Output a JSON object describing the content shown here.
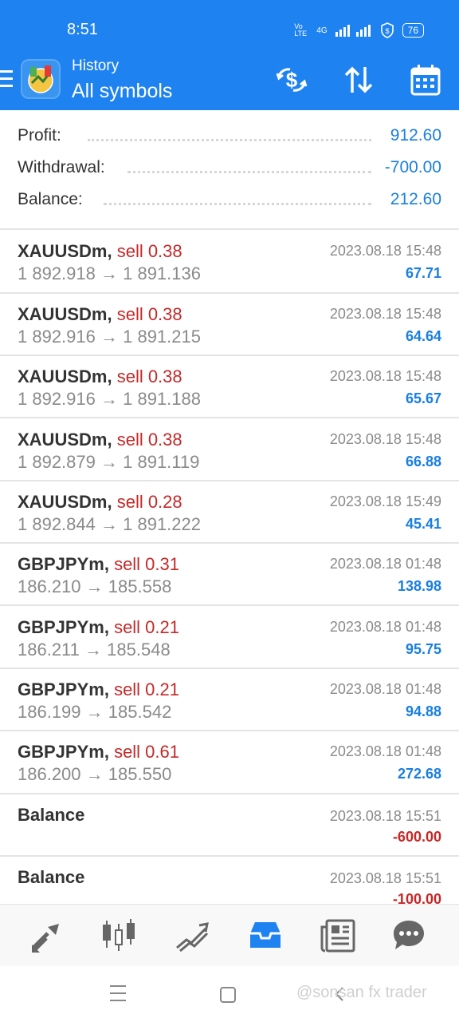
{
  "status": {
    "time": "8:51",
    "network": "Vo LTE",
    "signal": "4G",
    "battery": "76"
  },
  "toolbar": {
    "title": "History",
    "subtitle": "All symbols",
    "icons": [
      "menu-icon",
      "app-logo",
      "currency-exchange-icon",
      "sort-icon",
      "calendar-icon"
    ]
  },
  "summary": {
    "profit_label": "Profit:",
    "profit_value": "912.60",
    "withdrawal_label": "Withdrawal:",
    "withdrawal_value": "-700.00",
    "balance_label": "Balance:",
    "balance_value": "212.60"
  },
  "deals": [
    {
      "symbol": "XAUUSDm,",
      "type": "sell 0.38",
      "open": "1 892.918",
      "arrow": "→",
      "close": "1 891.136",
      "time": "2023.08.18 15:48",
      "profit": "67.71"
    },
    {
      "symbol": "XAUUSDm,",
      "type": "sell 0.38",
      "open": "1 892.916",
      "arrow": "→",
      "close": "1 891.215",
      "time": "2023.08.18 15:48",
      "profit": "64.64"
    },
    {
      "symbol": "XAUUSDm,",
      "type": "sell 0.38",
      "open": "1 892.916",
      "arrow": "→",
      "close": "1 891.188",
      "time": "2023.08.18 15:48",
      "profit": "65.67"
    },
    {
      "symbol": "XAUUSDm,",
      "type": "sell 0.38",
      "open": "1 892.879",
      "arrow": "→",
      "close": "1 891.119",
      "time": "2023.08.18 15:48",
      "profit": "66.88"
    },
    {
      "symbol": "XAUUSDm,",
      "type": "sell 0.28",
      "open": "1 892.844",
      "arrow": "→",
      "close": "1 891.222",
      "time": "2023.08.18 15:49",
      "profit": "45.41"
    },
    {
      "symbol": "GBPJPYm,",
      "type": "sell 0.31",
      "open": "186.210",
      "arrow": "→",
      "close": "185.558",
      "time": "2023.08.18 01:48",
      "profit": "138.98"
    },
    {
      "symbol": "GBPJPYm,",
      "type": "sell 0.21",
      "open": "186.211",
      "arrow": "→",
      "close": "185.548",
      "time": "2023.08.18 01:48",
      "profit": "95.75"
    },
    {
      "symbol": "GBPJPYm,",
      "type": "sell 0.21",
      "open": "186.199",
      "arrow": "→",
      "close": "185.542",
      "time": "2023.08.18 01:48",
      "profit": "94.88"
    },
    {
      "symbol": "GBPJPYm,",
      "type": "sell 0.61",
      "open": "186.200",
      "arrow": "→",
      "close": "185.550",
      "time": "2023.08.18 01:48",
      "profit": "272.68"
    }
  ],
  "balances": [
    {
      "label": "Balance",
      "time": "2023.08.18 15:51",
      "amount": "-600.00"
    },
    {
      "label": "Balance",
      "time": "2023.08.18 15:51",
      "amount": "-100.00"
    }
  ],
  "bottom_nav": [
    "quotes-icon",
    "chart-icon",
    "trade-icon",
    "history-icon",
    "news-icon",
    "messages-icon"
  ],
  "active_tab": "history-icon",
  "watermark": "@sonsan fx trader",
  "colors": {
    "accent": "#1e82f0",
    "profit": "#1a7fe0",
    "sell": "#c62828"
  }
}
